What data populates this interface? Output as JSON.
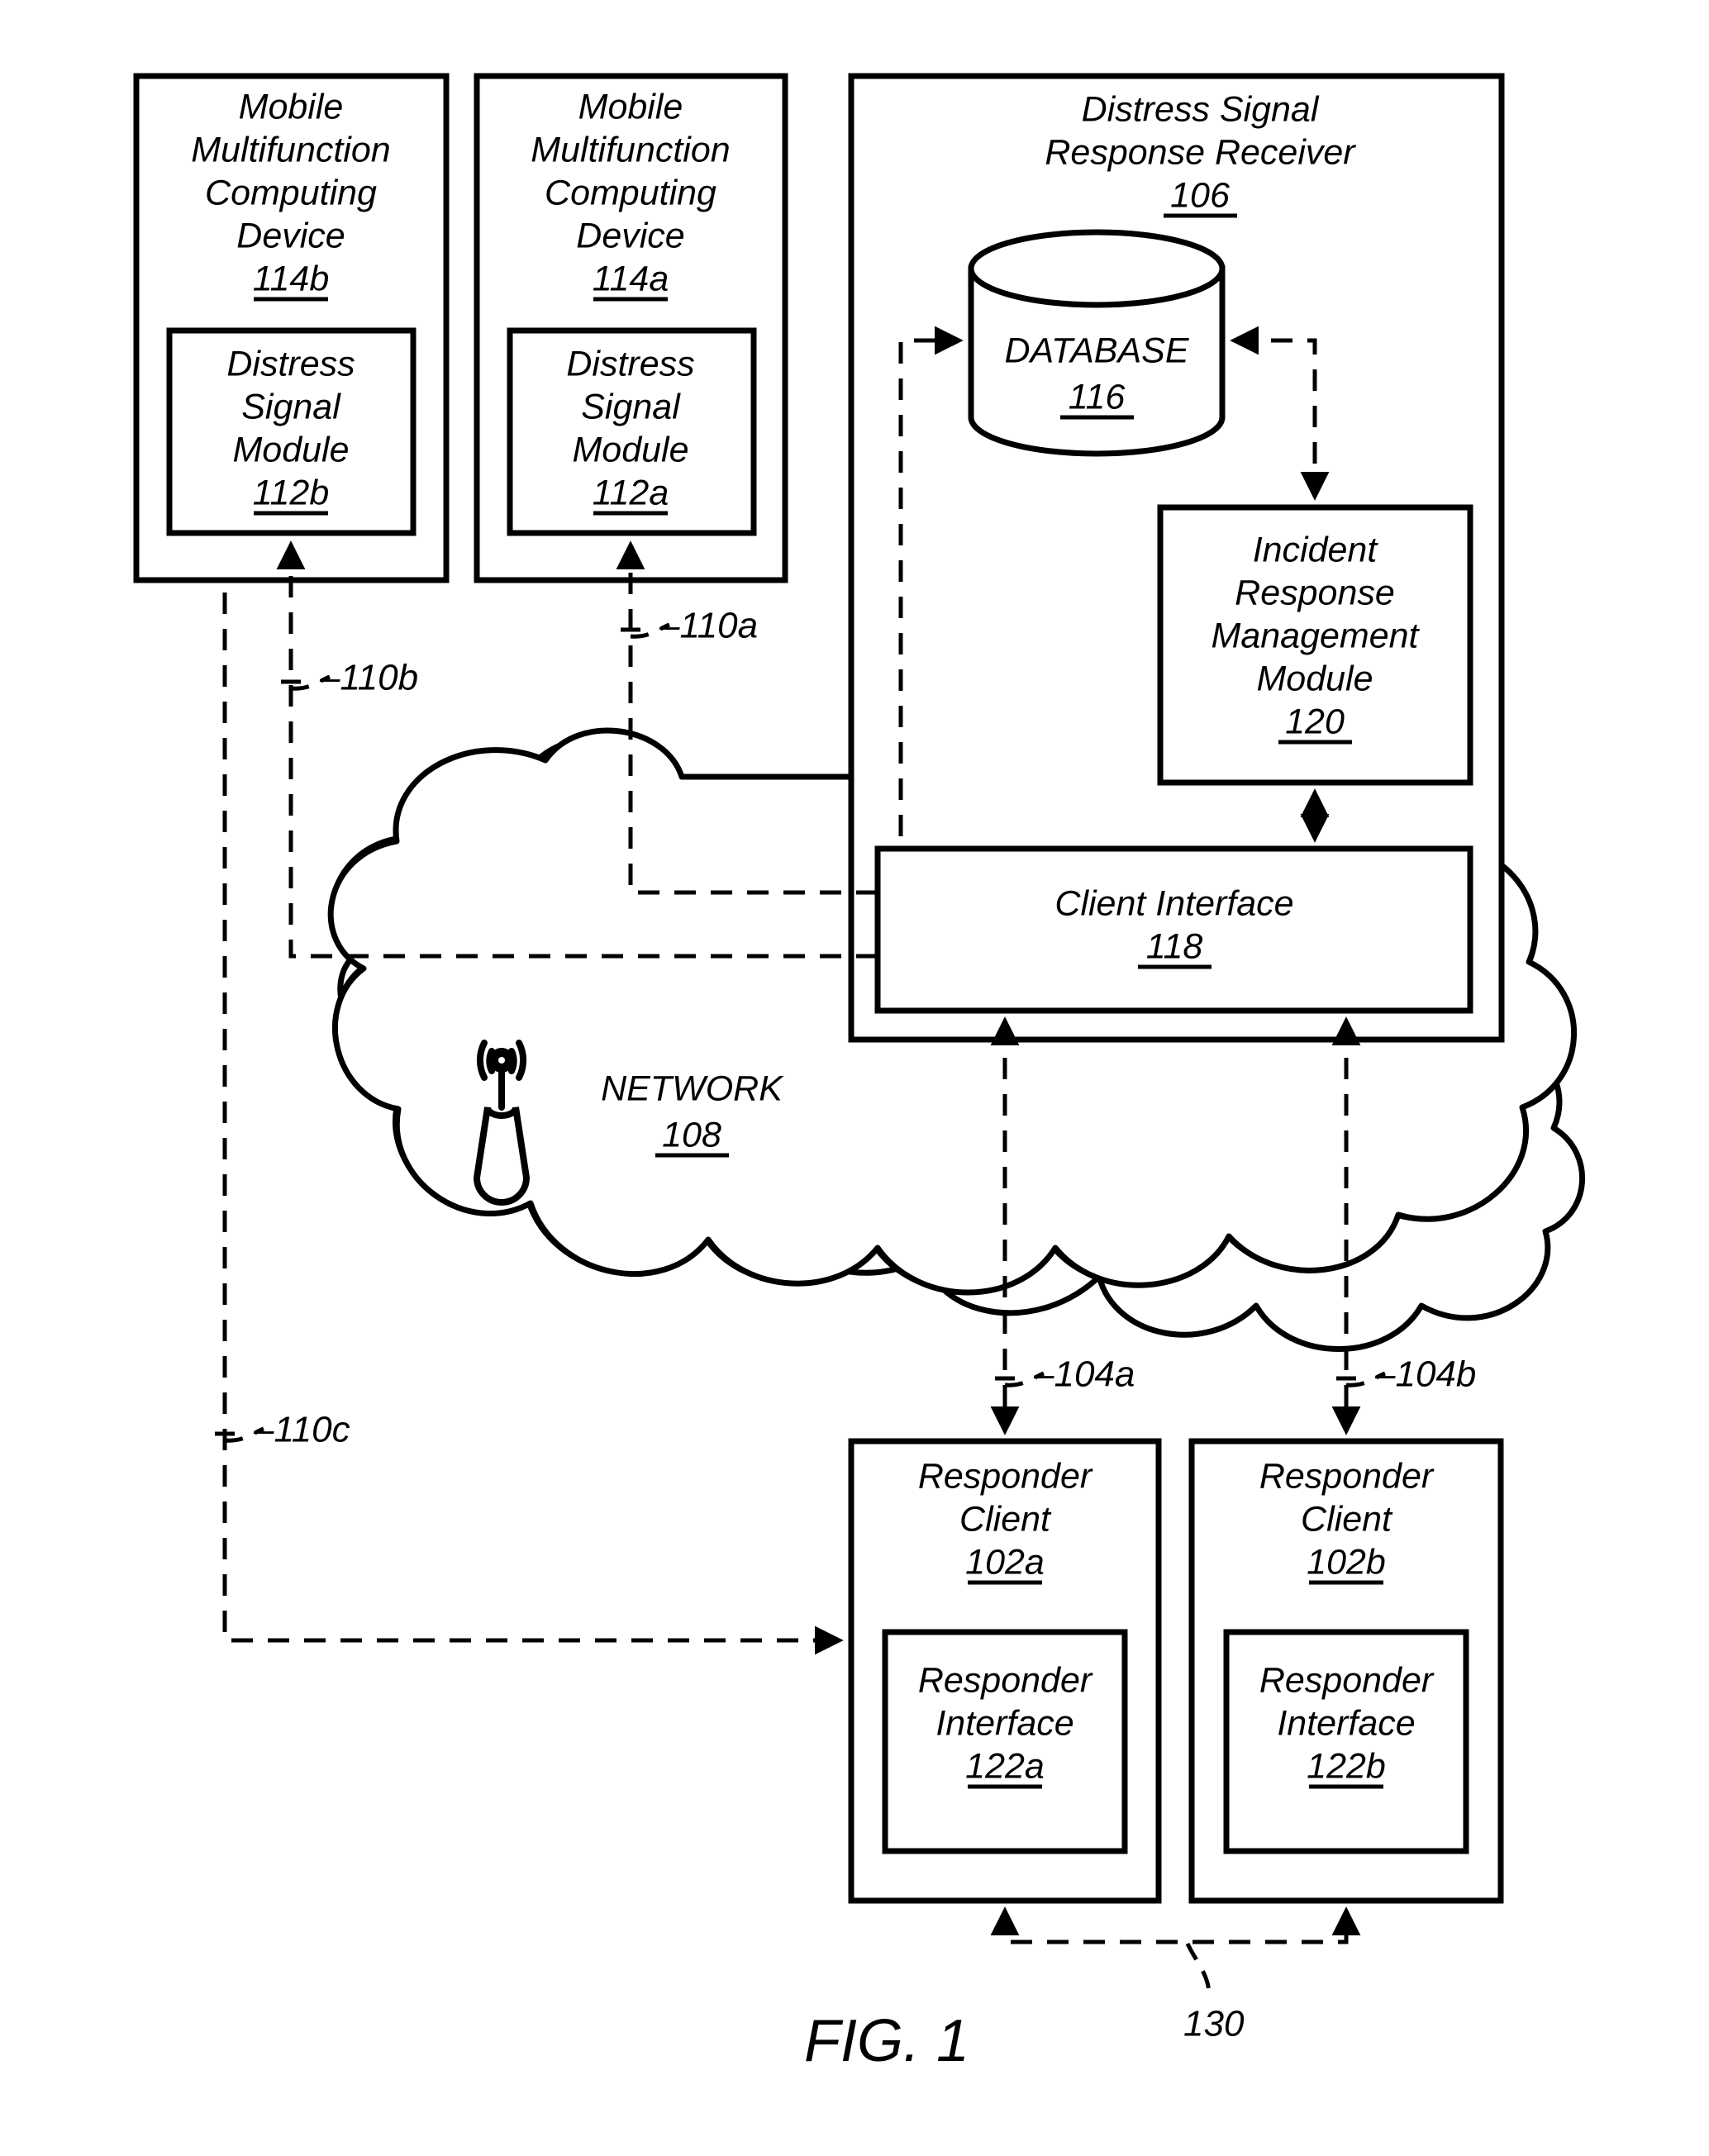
{
  "figure": {
    "caption": "FIG. 1",
    "background_color": "#ffffff",
    "line_color": "#000000"
  },
  "nodes": {
    "device_b": {
      "title_lines": [
        "Mobile",
        "Multifunction",
        "Computing",
        "Device"
      ],
      "ref": "114b",
      "module": {
        "title_lines": [
          "Distress",
          "Signal",
          "Module"
        ],
        "ref": "112b"
      }
    },
    "device_a": {
      "title_lines": [
        "Mobile",
        "Multifunction",
        "Computing",
        "Device"
      ],
      "ref": "114a",
      "module": {
        "title_lines": [
          "Distress",
          "Signal",
          "Module"
        ],
        "ref": "112a"
      }
    },
    "receiver": {
      "title_lines": [
        "Distress Signal",
        "Response Receiver"
      ],
      "ref": "106",
      "database": {
        "title": "DATABASE",
        "ref": "116"
      },
      "incident_module": {
        "title_lines": [
          "Incident",
          "Response",
          "Management",
          "Module"
        ],
        "ref": "120"
      },
      "client_interface": {
        "title": "Client Interface",
        "ref": "118"
      }
    },
    "network": {
      "title": "NETWORK",
      "ref": "108",
      "icon": "antenna-tower-icon"
    },
    "responder_a": {
      "title_lines": [
        "Responder",
        "Client"
      ],
      "ref": "102a",
      "interface": {
        "title_lines": [
          "Responder",
          "Interface"
        ],
        "ref": "122a"
      }
    },
    "responder_b": {
      "title_lines": [
        "Responder",
        "Client"
      ],
      "ref": "102b",
      "interface": {
        "title_lines": [
          "Responder",
          "Interface"
        ],
        "ref": "122b"
      }
    }
  },
  "connector_refs": {
    "r110a": "–110a",
    "r110b": "–110b",
    "r110c": "–110c",
    "r104a": "–104a",
    "r104b": "–104b",
    "r130": "130"
  }
}
